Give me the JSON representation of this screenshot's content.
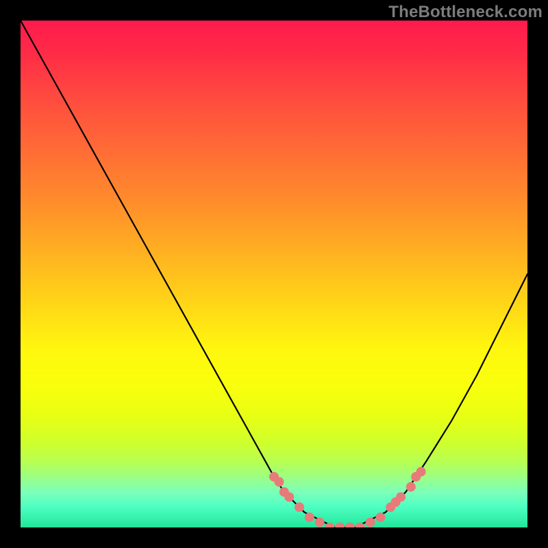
{
  "watermark": "TheBottleneck.com",
  "colors": {
    "background": "#000000",
    "curve": "#000000",
    "markers": "#e87a7a",
    "watermark_text": "#7c7c7c"
  },
  "chart_data": {
    "type": "line",
    "title": "",
    "xlabel": "",
    "ylabel": "",
    "x": [
      0.0,
      0.05,
      0.1,
      0.15,
      0.2,
      0.25,
      0.3,
      0.35,
      0.4,
      0.45,
      0.5,
      0.52,
      0.54,
      0.56,
      0.58,
      0.6,
      0.62,
      0.64,
      0.66,
      0.68,
      0.7,
      0.72,
      0.74,
      0.76,
      0.78,
      0.8,
      0.85,
      0.9,
      0.95,
      1.0
    ],
    "values": [
      1.0,
      0.91,
      0.82,
      0.73,
      0.64,
      0.55,
      0.46,
      0.37,
      0.28,
      0.19,
      0.1,
      0.07,
      0.05,
      0.03,
      0.02,
      0.01,
      0.0,
      0.0,
      0.0,
      0.01,
      0.02,
      0.03,
      0.05,
      0.07,
      0.1,
      0.13,
      0.21,
      0.3,
      0.4,
      0.5
    ],
    "xlim": [
      0,
      1
    ],
    "ylim": [
      0,
      1
    ],
    "marker_points": [
      {
        "x": 0.5,
        "y": 0.1
      },
      {
        "x": 0.51,
        "y": 0.09
      },
      {
        "x": 0.52,
        "y": 0.07
      },
      {
        "x": 0.53,
        "y": 0.06
      },
      {
        "x": 0.55,
        "y": 0.04
      },
      {
        "x": 0.57,
        "y": 0.02
      },
      {
        "x": 0.59,
        "y": 0.01
      },
      {
        "x": 0.61,
        "y": 0.0
      },
      {
        "x": 0.63,
        "y": 0.0
      },
      {
        "x": 0.65,
        "y": 0.0
      },
      {
        "x": 0.67,
        "y": 0.0
      },
      {
        "x": 0.69,
        "y": 0.01
      },
      {
        "x": 0.71,
        "y": 0.02
      },
      {
        "x": 0.73,
        "y": 0.04
      },
      {
        "x": 0.74,
        "y": 0.05
      },
      {
        "x": 0.75,
        "y": 0.06
      },
      {
        "x": 0.77,
        "y": 0.08
      },
      {
        "x": 0.78,
        "y": 0.1
      },
      {
        "x": 0.79,
        "y": 0.11
      }
    ]
  }
}
